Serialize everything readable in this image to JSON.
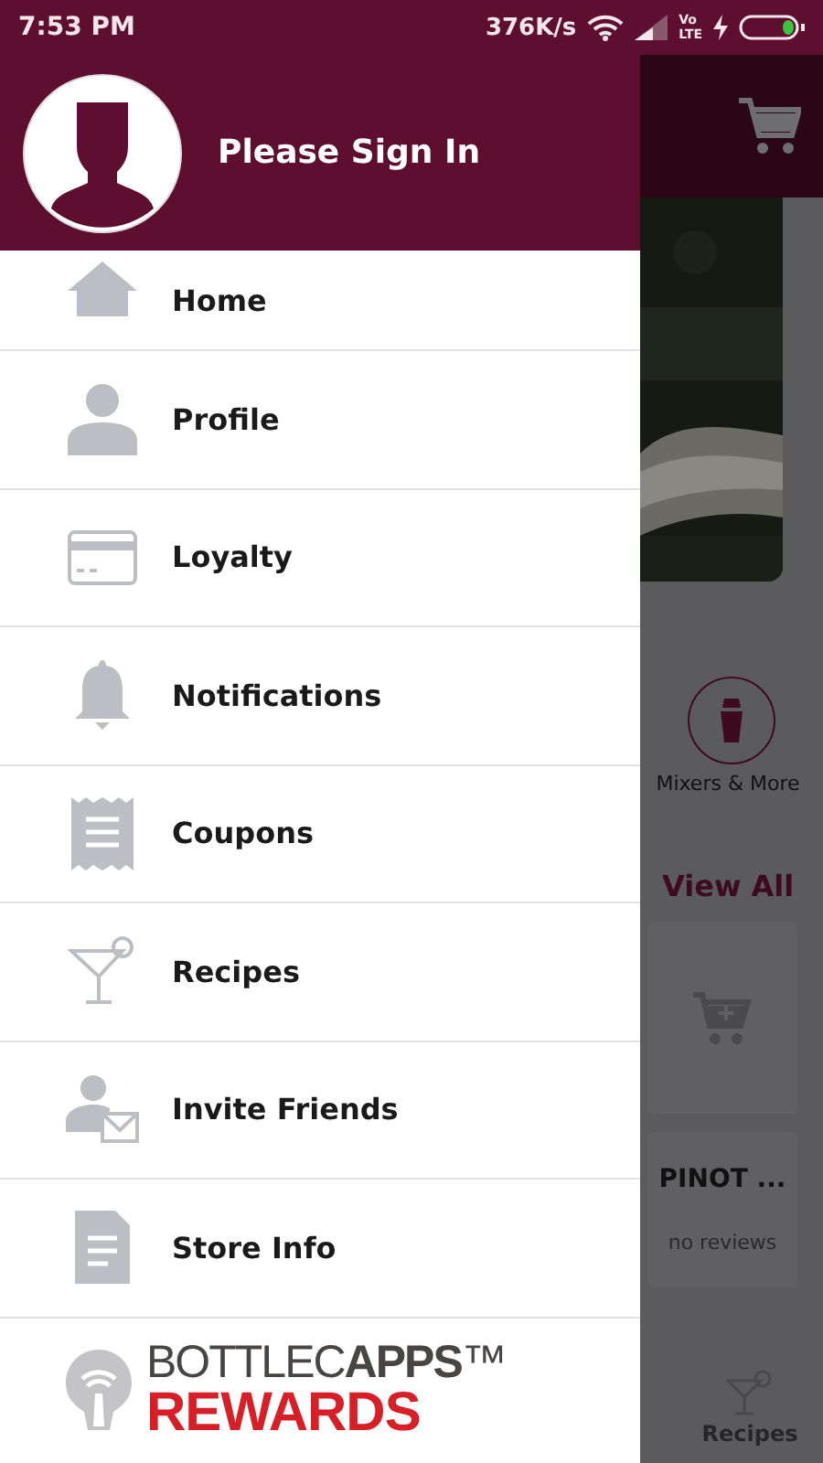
{
  "status_bar": {
    "time": "7:53 PM",
    "speed": "376K/s",
    "volte": [
      "Vo",
      "LTE"
    ],
    "charging": true
  },
  "drawer": {
    "header": {
      "title": "Please Sign In"
    },
    "items": [
      {
        "label": "Home",
        "selected": false
      },
      {
        "label": "Profile",
        "selected": false
      },
      {
        "label": "Loyalty",
        "selected": false
      },
      {
        "label": "Notifications",
        "selected": false
      },
      {
        "label": "Coupons",
        "selected": false
      },
      {
        "label": "Recipes",
        "selected": false
      },
      {
        "label": "Invite Friends",
        "selected": false
      },
      {
        "label": "Store Info",
        "selected": false
      }
    ],
    "logo": {
      "brand": "BOTTLEC**APPS**™",
      "tagline": "REWARDS"
    }
  },
  "background": {
    "category": "Mixers & More",
    "view_all": "View All",
    "product": {
      "name": "PINOT ...",
      "reviews": "no reviews"
    },
    "nav": "Recipes"
  }
}
